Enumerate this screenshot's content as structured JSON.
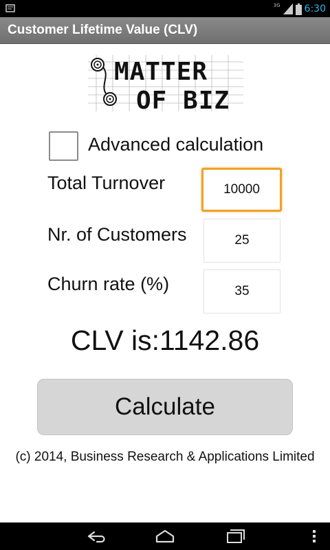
{
  "status_bar": {
    "time": "6:30",
    "network": "3G",
    "icons": [
      "notification-icon",
      "signal-icon",
      "battery-icon"
    ],
    "accent_color": "#33b5e5"
  },
  "app": {
    "title": "Customer Lifetime Value (CLV)"
  },
  "logo": {
    "line1": "MATTER",
    "line2": "OF BIZ"
  },
  "advanced": {
    "label": "Advanced calculation",
    "checked": false
  },
  "fields": {
    "turnover": {
      "label": "Total Turnover",
      "value": "10000"
    },
    "customers": {
      "label": "Nr. of Customers",
      "value": "25"
    },
    "churn": {
      "label": "Churn rate (%)",
      "value": "35"
    }
  },
  "result": {
    "text": "CLV is:1142.86"
  },
  "calculate_button": {
    "label": "Calculate"
  },
  "footer": {
    "text": "(c) 2014, Business Research & Applications Limited"
  },
  "nav_bar": {
    "icons": [
      "back-icon",
      "home-icon",
      "recents-icon",
      "menu-icon"
    ]
  },
  "colors": {
    "focus_border": "#f0a02a",
    "button_bg": "#d6d6d6",
    "title_bar": "#7a7a7a"
  }
}
